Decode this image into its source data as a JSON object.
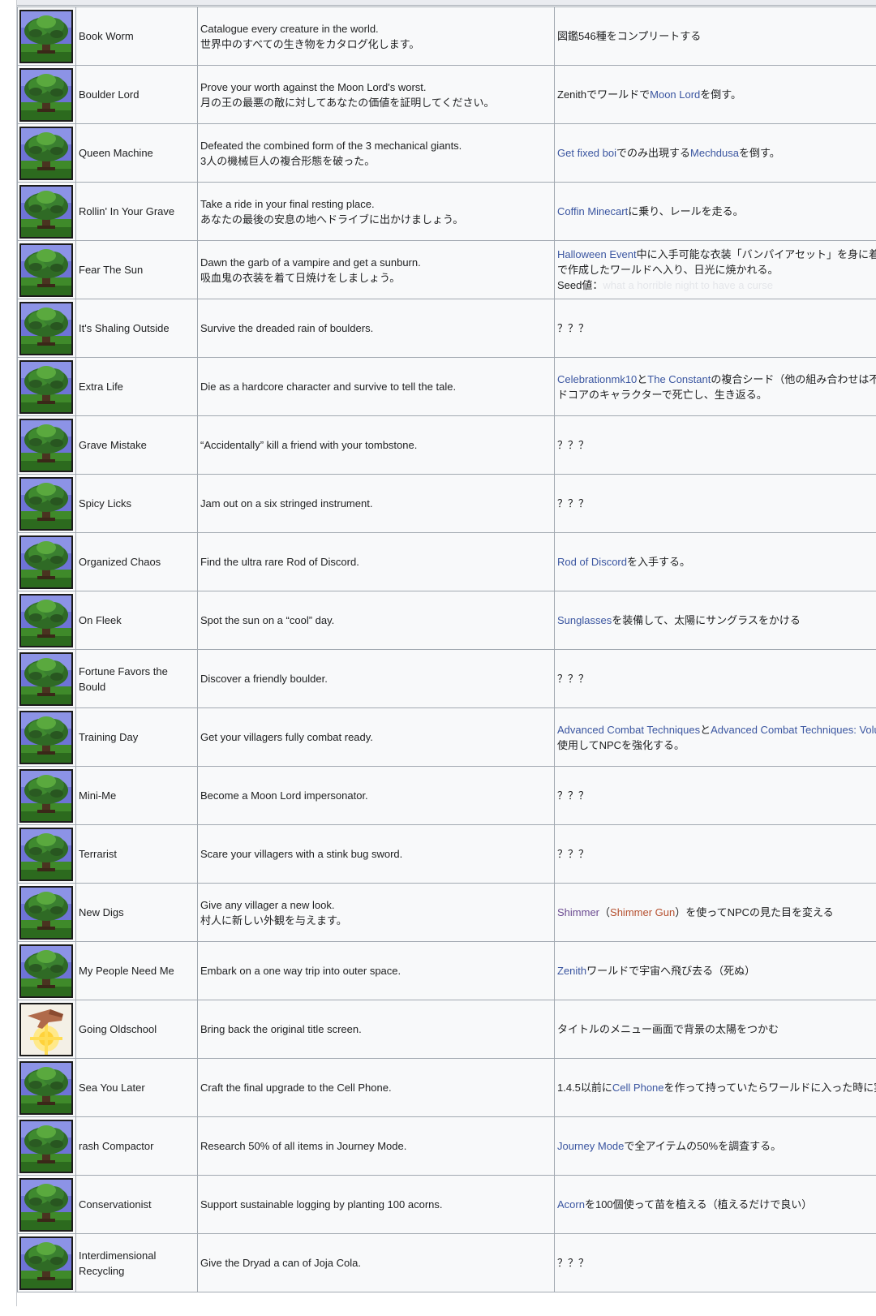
{
  "rows": [
    {
      "icon": "tree-icon",
      "name": "Book Worm",
      "desc": [
        "Catalogue every creature in the world.",
        "世界中のすべての生き物をカタログ化します。"
      ],
      "cond": [
        [
          "図鑑546種をコンプリートする"
        ]
      ]
    },
    {
      "icon": "tree-icon",
      "name": "Boulder Lord",
      "desc": [
        "Prove your worth against the Moon Lord's worst.",
        "月の王の最悪の敵に対してあなたの価値を証明してください。"
      ],
      "cond": [
        [
          "Zenithでワールドで",
          {
            "link": "Moon Lord"
          },
          "を倒す。"
        ]
      ]
    },
    {
      "icon": "tree-icon",
      "name": "Queen Machine",
      "desc": [
        "Defeated the combined form of the 3 mechanical giants.",
        "3人の機械巨人の複合形態を破った。"
      ],
      "cond": [
        [
          {
            "link": "Get fixed boi"
          },
          "でのみ出現する",
          {
            "link": "Mechdusa"
          },
          "を倒す。"
        ]
      ]
    },
    {
      "icon": "tree-icon",
      "name": "Rollin' In Your Grave",
      "desc": [
        "Take a ride in your final resting place.",
        "あなたの最後の安息の地へドライブに出かけましょう。"
      ],
      "cond": [
        [
          {
            "link": "Coffin Minecart"
          },
          "に乗り、レールを走る。"
        ]
      ]
    },
    {
      "icon": "tree-icon",
      "name": "Fear The Sun",
      "desc": [
        "Dawn the garb of a vampire and get a sunburn.",
        "吸血鬼の衣装を着て日焼けをしましょう。"
      ],
      "cond": [
        [
          {
            "link": "Halloween Event"
          },
          "中に入手可能な衣装「バンパイアセット」を身に着け"
        ],
        [
          "で作成したワールドへ入り、日光に焼かれる。"
        ],
        [
          "Seed値：",
          {
            "faint": "what a horrible night to have a curse"
          }
        ]
      ]
    },
    {
      "icon": "tree-icon",
      "name": "It's Shaling Outside",
      "desc": [
        "Survive the dreaded rain of boulders."
      ],
      "cond": [
        [
          "？？？"
        ]
      ]
    },
    {
      "icon": "tree-icon",
      "name": "Extra Life",
      "desc": [
        "Die as a hardcore character and survive to tell the tale."
      ],
      "cond": [
        [
          {
            "link": "Celebrationmk10"
          },
          "と",
          {
            "link": "The Constant"
          },
          "の複合シード（他の組み合わせは不明"
        ],
        [
          "ドコアのキャラクターで死亡し、生き返る。"
        ]
      ]
    },
    {
      "icon": "tree-icon",
      "name": "Grave Mistake",
      "desc": [
        "“Accidentally” kill a friend with your tombstone."
      ],
      "cond": [
        [
          "？？？"
        ]
      ]
    },
    {
      "icon": "tree-icon",
      "name": "Spicy Licks",
      "desc": [
        "Jam out on a six stringed instrument."
      ],
      "cond": [
        [
          "？？？"
        ]
      ]
    },
    {
      "icon": "tree-icon",
      "name": "Organized Chaos",
      "desc": [
        "Find the ultra rare Rod of Discord."
      ],
      "cond": [
        [
          {
            "link": "Rod of Discord"
          },
          "を入手する。"
        ]
      ]
    },
    {
      "icon": "tree-icon",
      "name": "On Fleek",
      "desc": [
        "Spot the sun on a “cool” day."
      ],
      "cond": [
        [
          {
            "link": "Sunglasses"
          },
          "を装備して、太陽にサングラスをかける"
        ]
      ]
    },
    {
      "icon": "tree-icon",
      "name": "Fortune Favors the Bould",
      "desc": [
        "Discover a friendly boulder."
      ],
      "cond": [
        [
          "？？？"
        ]
      ]
    },
    {
      "icon": "tree-icon",
      "name": "Training Day",
      "desc": [
        "Get your villagers fully combat ready."
      ],
      "cond": [
        [
          {
            "link": "Advanced Combat Techniques"
          },
          "と",
          {
            "link": "Advanced Combat Techniques: Volum"
          }
        ],
        [
          "使用してNPCを強化する。"
        ]
      ]
    },
    {
      "icon": "tree-icon",
      "name": "Mini-Me",
      "desc": [
        "Become a Moon Lord impersonator."
      ],
      "cond": [
        [
          "？？？"
        ]
      ]
    },
    {
      "icon": "tree-icon",
      "name": "Terrarist",
      "desc": [
        "Scare your villagers with a stink bug sword."
      ],
      "cond": [
        [
          "？？？"
        ]
      ]
    },
    {
      "icon": "tree-icon",
      "name": "New Digs",
      "desc": [
        "Give any villager a new look.",
        "村人に新しい外観を与えます。"
      ],
      "cond": [
        [
          {
            "purple": "Shimmer"
          },
          "（",
          {
            "red": "Shimmer Gun"
          },
          "）を使ってNPCの見た目を変える"
        ]
      ]
    },
    {
      "icon": "tree-icon",
      "name": "My People Need Me",
      "desc": [
        "Embark on a one way trip into outer space."
      ],
      "cond": [
        [
          {
            "link": "Zenith"
          },
          "ワールドで宇宙へ飛び去る（死ぬ）"
        ]
      ]
    },
    {
      "icon": "sun-hand-icon",
      "name": "Going Oldschool",
      "desc": [
        "Bring back the original title screen."
      ],
      "cond": [
        [
          "タイトルのメニュー画面で背景の太陽をつかむ"
        ]
      ]
    },
    {
      "icon": "tree-icon",
      "name": "Sea You Later",
      "desc": [
        "Craft the final upgrade to the Cell Phone."
      ],
      "cond": [
        [
          "1.4.5以前に",
          {
            "link": "Cell Phone"
          },
          "を作って持っていたらワールドに入った時に実績"
        ]
      ]
    },
    {
      "icon": "tree-icon",
      "name": "rash Compactor",
      "desc": [
        "Research 50% of all items in Journey Mode."
      ],
      "cond": [
        [
          {
            "link": "Journey Mode"
          },
          "で全アイテムの50%を調査する。"
        ]
      ]
    },
    {
      "icon": "tree-icon",
      "name": "Conservationist",
      "desc": [
        "Support sustainable logging by planting 100 acorns."
      ],
      "cond": [
        [
          {
            "link": "Acorn"
          },
          "を100個使って苗を植える（植えるだけで良い）"
        ]
      ]
    },
    {
      "icon": "tree-icon",
      "name": "Interdimensional Recycling",
      "desc": [
        "Give the Dryad a can of Joja Cola."
      ],
      "cond": [
        [
          "？？？"
        ]
      ]
    }
  ],
  "colors": {
    "link": "#3a55a0",
    "link_red": "#b5502f",
    "link_purple": "#6b4b91",
    "border": "#a2a9b1",
    "cell_bg": "#f8f9fa"
  }
}
